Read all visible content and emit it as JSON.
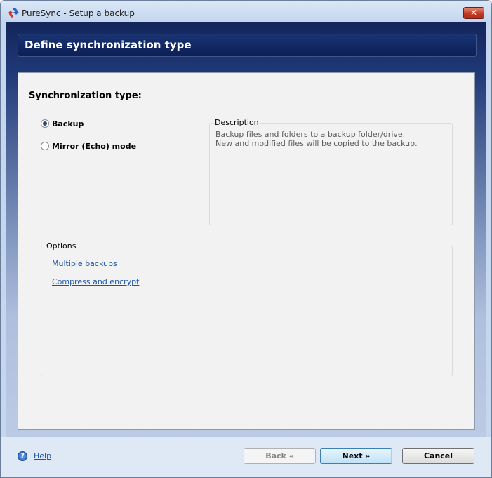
{
  "window": {
    "title": "PureSync - Setup a backup",
    "close_glyph": "✕"
  },
  "header": {
    "title": "Define synchronization type"
  },
  "sync_type": {
    "label": "Synchronization type:",
    "options": [
      {
        "label": "Backup",
        "selected": true
      },
      {
        "label": "Mirror (Echo) mode",
        "selected": false
      }
    ]
  },
  "description": {
    "legend": "Description",
    "lines": [
      "Backup files and folders to a backup folder/drive.",
      "New and modified files will be copied to the backup."
    ]
  },
  "options_group": {
    "legend": "Options",
    "links": [
      "Multiple backups",
      "Compress and encrypt"
    ]
  },
  "footer": {
    "help_icon_glyph": "?",
    "help_label": "Help",
    "back_label": "Back «",
    "next_label": "Next »",
    "cancel_label": "Cancel"
  },
  "icons": {
    "app": "sync-arrows-icon",
    "help": "help-icon",
    "close": "close-icon"
  },
  "colors": {
    "header_band": "#0c1f56",
    "link": "#1a56a8",
    "close_button": "#c23a22",
    "default_button_border": "#3c7fb1"
  }
}
